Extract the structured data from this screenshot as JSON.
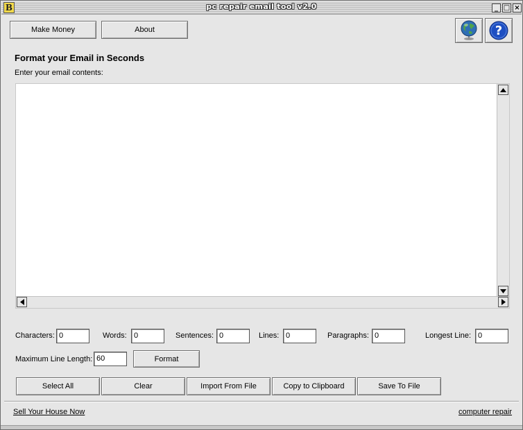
{
  "window": {
    "title": "pc repair email tool v2.0",
    "app_icon_glyph": "B"
  },
  "window_controls": {
    "minimize": "_",
    "maximize": "□",
    "close": "×"
  },
  "top_buttons": {
    "make_money": "Make Money",
    "about": "About"
  },
  "icons": {
    "globe": "globe-icon",
    "help": "help-icon",
    "help_glyph": "?"
  },
  "heading": "Format your Email in Seconds",
  "prompt": "Enter your email contents:",
  "email_body": "",
  "stats": {
    "characters": {
      "label": "Characters:",
      "value": "0"
    },
    "words": {
      "label": "Words:",
      "value": "0"
    },
    "sentences": {
      "label": "Sentences:",
      "value": "0"
    },
    "lines": {
      "label": "Lines:",
      "value": "0"
    },
    "paragraphs": {
      "label": "Paragraphs:",
      "value": "0"
    },
    "longest_line": {
      "label": "Longest Line:",
      "value": "0"
    }
  },
  "max_line": {
    "label": "Maximum Line Length:",
    "value": "60"
  },
  "format_button": "Format",
  "actions": {
    "select_all": "Select All",
    "clear": "Clear",
    "import": "Import From File",
    "copy": "Copy to Clipboard",
    "save": "Save To File"
  },
  "footer": {
    "left_link": "Sell Your House Now",
    "right_link": "computer repair"
  },
  "colors": {
    "window_bg": "#e6e6e6",
    "globe_blue": "#2f6fb5",
    "help_blue": "#1e4fc2"
  }
}
